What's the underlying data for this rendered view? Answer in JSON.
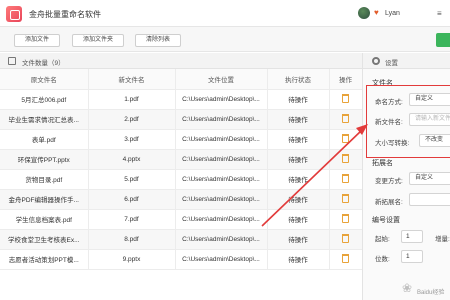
{
  "app": {
    "title": "金舟批量重命名软件"
  },
  "user": {
    "name": "Lyan",
    "menu_glyph": "≡"
  },
  "toolbar": {
    "add_files": "添加文件",
    "add_folder": "添加文件夹",
    "clear_list": "清除列表"
  },
  "file_list": {
    "title": "文件数量（9）",
    "columns": [
      "原文件名",
      "新文件名",
      "文件位置",
      "执行状态",
      "操作"
    ],
    "rows": [
      {
        "original": "5月汇总006.pdf",
        "new": "1.pdf",
        "location": "C:\\Users\\admin\\Desktop\\...",
        "status": "待操作"
      },
      {
        "original": "毕业生需求情况汇总表...",
        "new": "2.pdf",
        "location": "C:\\Users\\admin\\Desktop\\...",
        "status": "待操作"
      },
      {
        "original": "表单.pdf",
        "new": "3.pdf",
        "location": "C:\\Users\\admin\\Desktop\\...",
        "status": "待操作"
      },
      {
        "original": "环保宣传PPT.pptx",
        "new": "4.pptx",
        "location": "C:\\Users\\admin\\Desktop\\...",
        "status": "待操作"
      },
      {
        "original": "货物目录.pdf",
        "new": "5.pdf",
        "location": "C:\\Users\\admin\\Desktop\\...",
        "status": "待操作"
      },
      {
        "original": "金舟PDF编辑器操作手...",
        "new": "6.pdf",
        "location": "C:\\Users\\admin\\Desktop\\...",
        "status": "待操作"
      },
      {
        "original": "学生信息档案表.pdf",
        "new": "7.pdf",
        "location": "C:\\Users\\admin\\Desktop\\...",
        "status": "待操作"
      },
      {
        "original": "学校食堂卫生考核表Ex...",
        "new": "8.pdf",
        "location": "C:\\Users\\admin\\Desktop\\...",
        "status": "待操作"
      },
      {
        "original": "志愿者活动策划PPT模...",
        "new": "9.pptx",
        "location": "C:\\Users\\admin\\Desktop\\...",
        "status": "待操作"
      }
    ]
  },
  "settings": {
    "title": "设置",
    "filename_section": "文件名",
    "naming_mode_label": "命名方式:",
    "naming_mode_value": "自定义",
    "new_filename_label": "新文件名:",
    "new_filename_placeholder": "请输入新文件名",
    "case_label": "大小写转换:",
    "case_value": "不改变",
    "ext_section": "拓展名",
    "change_ext_label": "变更方式:",
    "change_ext_value": "自定义",
    "new_ext_label": "新拓展名:",
    "numbering_section": "编号设置",
    "start_label": "起始:",
    "start_value": "1",
    "increment_label": "增量:",
    "digits_label": "位数:",
    "digits_value": "1"
  },
  "watermark": {
    "text": "Baidu经验"
  },
  "colors": {
    "accent_red": "#e23b3b",
    "brand_green": "#3cb55c",
    "trash_orange": "#e8a33a"
  }
}
